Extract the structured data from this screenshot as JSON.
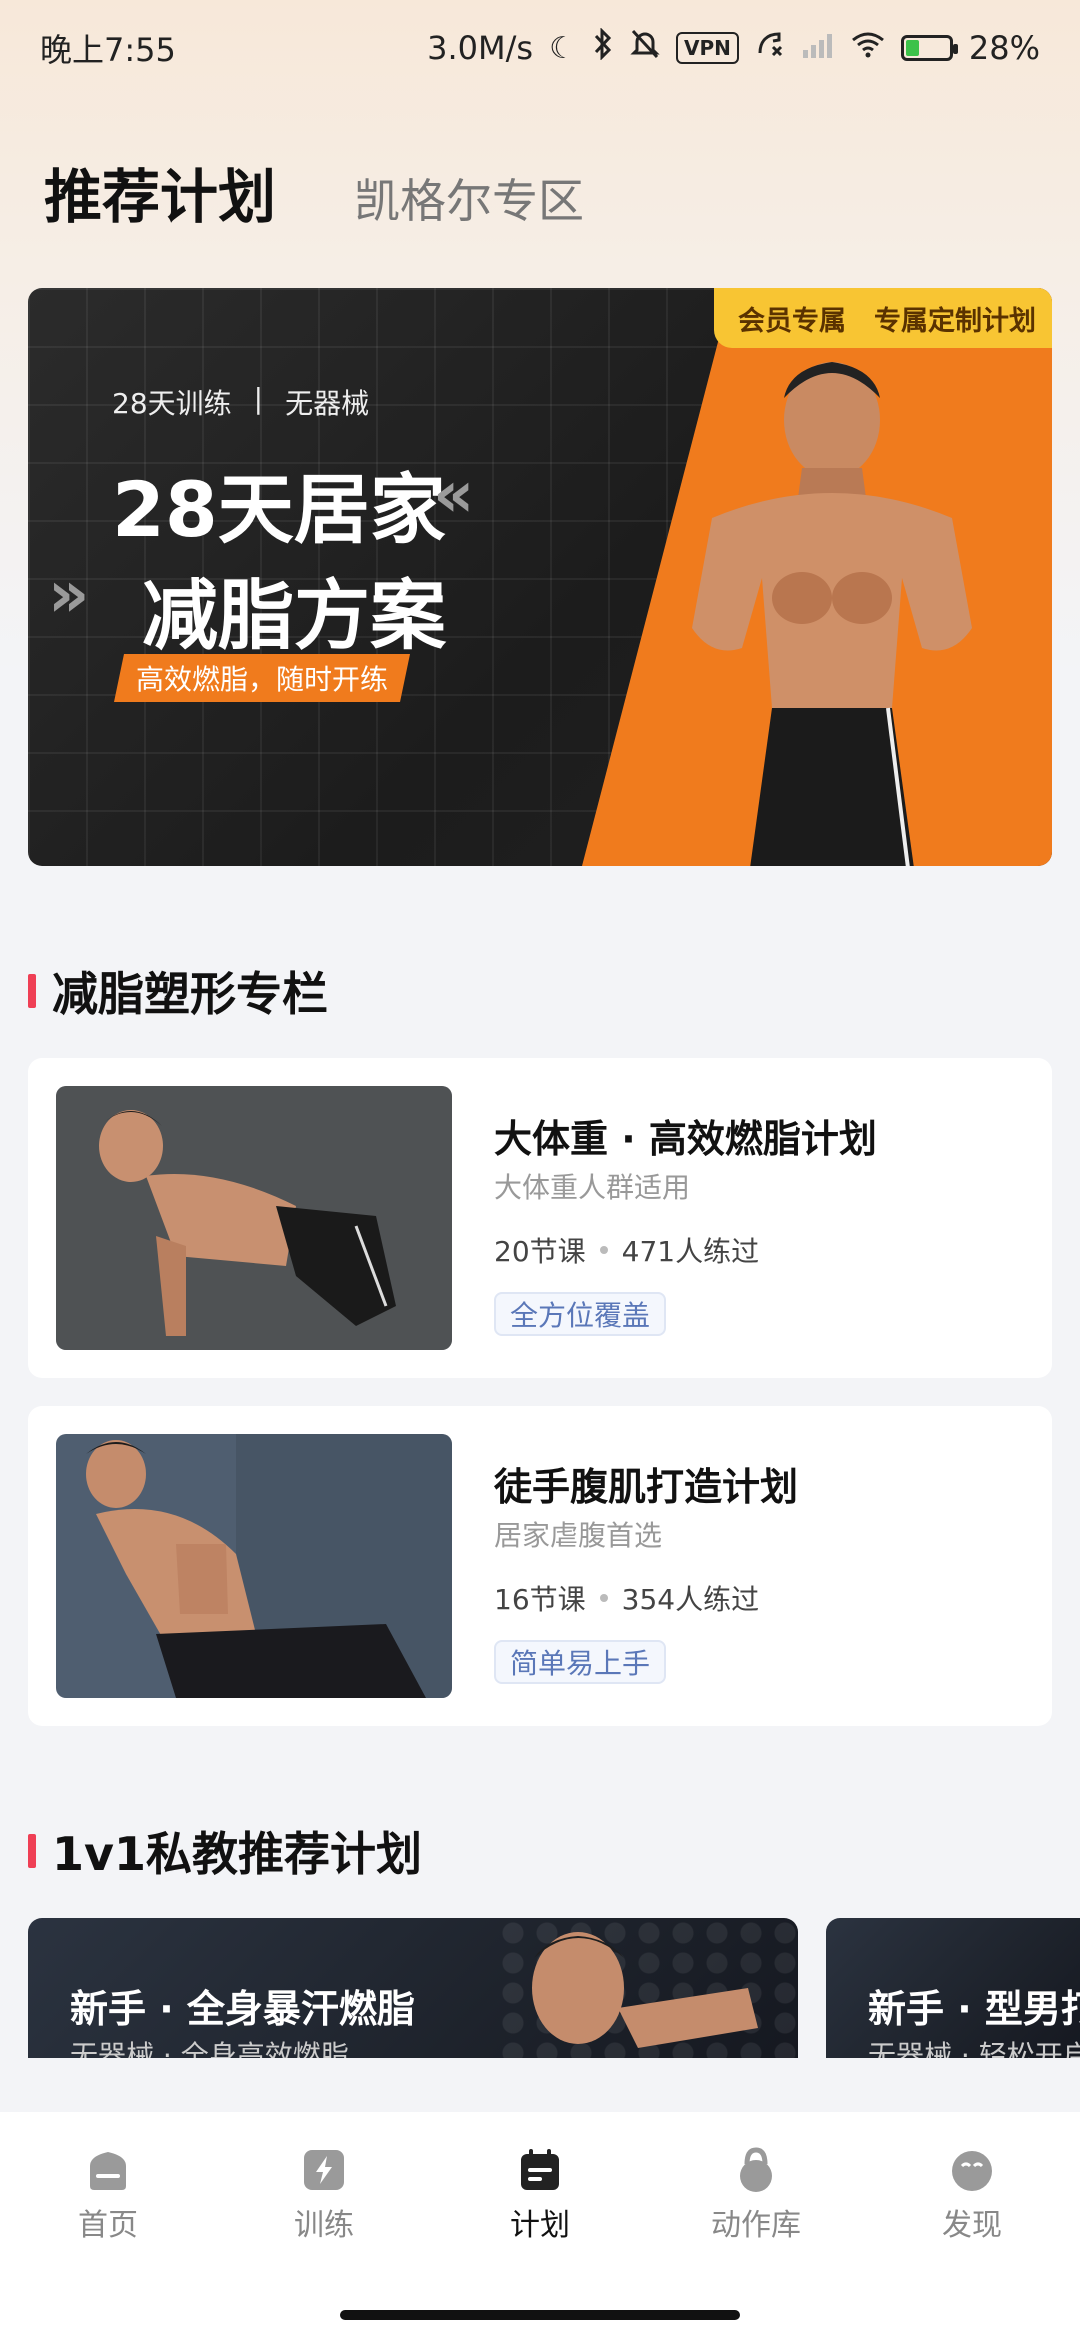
{
  "status_bar": {
    "time": "晚上7:55",
    "network_speed": "3.0M/s",
    "vpn": "VPN",
    "battery_level": 0.28,
    "battery_text": "28%"
  },
  "header": {
    "tabs": [
      {
        "label": "推荐计划",
        "active": true
      },
      {
        "label": "凯格尔专区",
        "active": false
      }
    ]
  },
  "banner": {
    "badge_left": "会员专属",
    "badge_right": "专属定制计划",
    "meta_left": "28天训练",
    "meta_sep": "|",
    "meta_right": "无器械",
    "title_line1": "28天居家",
    "title_line2": "减脂方案",
    "tag": "高效燃脂，随时开练"
  },
  "section_fatloss": {
    "title": "减脂塑形专栏",
    "plans": [
      {
        "title": "大体重 · 高效燃脂计划",
        "subtitle": "大体重人群适用",
        "lessons": "20节课",
        "trained": "471人练过",
        "tag": "全方位覆盖"
      },
      {
        "title": "徒手腹肌打造计划",
        "subtitle": "居家虐腹首选",
        "lessons": "16节课",
        "trained": "354人练过",
        "tag": "简单易上手"
      }
    ]
  },
  "section_coach": {
    "title": "1v1私教推荐计划",
    "cards": [
      {
        "title": "新手 · 全身暴汗燃脂",
        "subtitle": "无器械 · 全身高效燃脂"
      },
      {
        "title": "新手 · 型男打",
        "subtitle": "无器械 · 轻松开启"
      }
    ]
  },
  "bottom_nav": {
    "items": [
      {
        "label": "首页",
        "icon": "home-icon",
        "active": false
      },
      {
        "label": "训练",
        "icon": "lightning-icon",
        "active": false
      },
      {
        "label": "计划",
        "icon": "calendar-icon",
        "active": true
      },
      {
        "label": "动作库",
        "icon": "kettlebell-icon",
        "active": false
      },
      {
        "label": "发现",
        "icon": "discover-icon",
        "active": false
      }
    ]
  },
  "colors": {
    "accent_red": "#ef3f55",
    "orange": "#f07b1d",
    "gold_badge": "#f8c533",
    "tag_blue": "#5a77b8"
  }
}
